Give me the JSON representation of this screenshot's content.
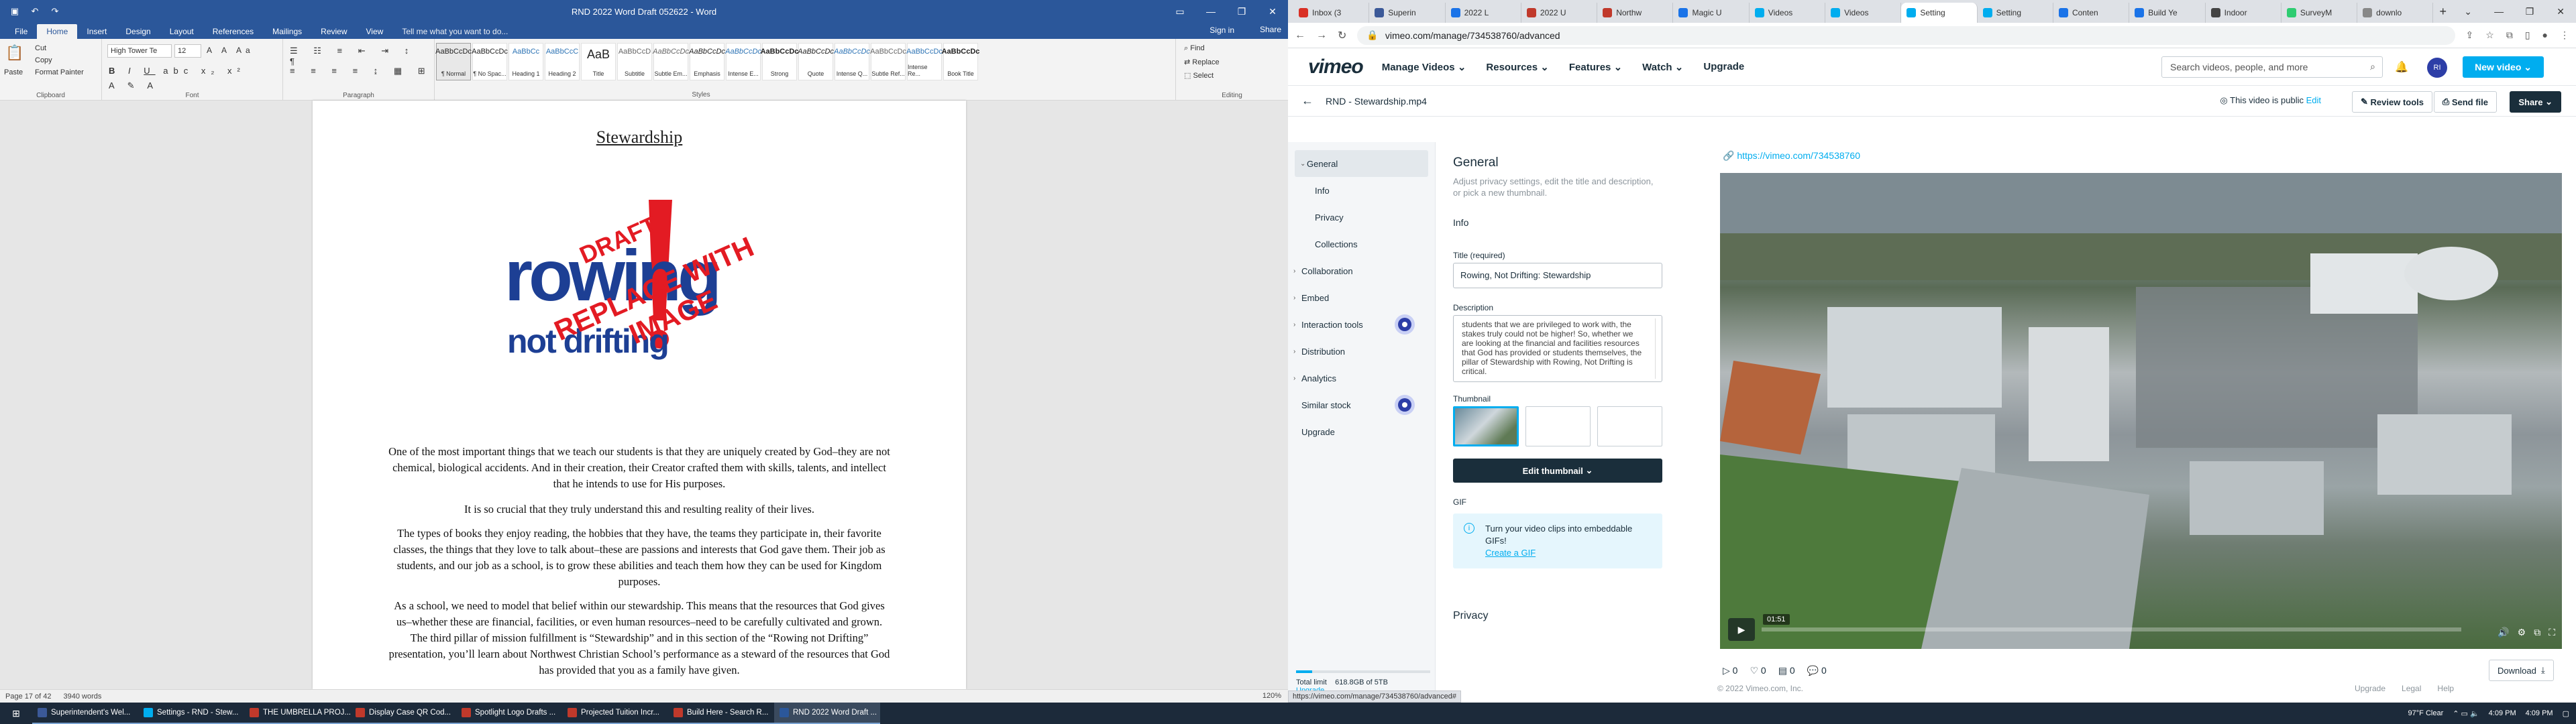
{
  "word": {
    "title": "RND 2022 Word Draft 052622 - Word",
    "sign_in": "Sign in",
    "share": "Share",
    "tabs": [
      "File",
      "Home",
      "Insert",
      "Design",
      "Layout",
      "References",
      "Mailings",
      "Review",
      "View"
    ],
    "tell_me": "Tell me what you want to do...",
    "clipboard": {
      "paste": "Paste",
      "cut": "Cut",
      "copy": "Copy",
      "format_painter": "Format Painter",
      "label": "Clipboard"
    },
    "font": {
      "name": "High Tower Te",
      "size": "12",
      "label": "Font"
    },
    "paragraph_label": "Paragraph",
    "styles": [
      {
        "preview": "AaBbCcDc",
        "name": "¶ Normal"
      },
      {
        "preview": "AaBbCcDc",
        "name": "¶ No Spac..."
      },
      {
        "preview": "AaBbCc",
        "name": "Heading 1"
      },
      {
        "preview": "AaBbCcC",
        "name": "Heading 2"
      },
      {
        "preview": "AaB",
        "name": "Title"
      },
      {
        "preview": "AaBbCcD",
        "name": "Subtitle"
      },
      {
        "preview": "AaBbCcDc",
        "name": "Subtle Em..."
      },
      {
        "preview": "AaBbCcDc",
        "name": "Emphasis"
      },
      {
        "preview": "AaBbCcDc",
        "name": "Intense E..."
      },
      {
        "preview": "AaBbCcDc",
        "name": "Strong"
      },
      {
        "preview": "AaBbCcDc",
        "name": "Quote"
      },
      {
        "preview": "AaBbCcDc",
        "name": "Intense Q..."
      },
      {
        "preview": "AaBbCcDc",
        "name": "Subtle Ref..."
      },
      {
        "preview": "AaBbCcDc",
        "name": "Intense Re..."
      },
      {
        "preview": "AaBbCcDc",
        "name": "Book Title"
      }
    ],
    "styles_label": "Styles",
    "editing": {
      "find": "Find",
      "replace": "Replace",
      "select": "Select",
      "label": "Editing"
    },
    "document": {
      "heading": "Stewardship",
      "logo": {
        "line1": "rowing",
        "line2": "not drifting",
        "stamp1": "DRAFT",
        "stamp2": "REPLACE WITH",
        "stamp3": "IMAGE"
      },
      "paragraphs": [
        "One of the most important things that we teach our students is that they are uniquely created by God–they are not chemical, biological accidents.  And in their creation, their Creator crafted them with skills, talents, and intellect that he intends to use for His purposes.",
        "It is so crucial that they truly understand this and resulting reality of their lives.",
        "The types of books they enjoy reading, the hobbies that they have, the teams they participate in, their favorite classes, the things that they love to talk about–these are passions and interests that God gave them.  Their job as students, and our job as a school, is to grow these abilities and teach them how they can be used for Kingdom purposes.",
        "As a school, we need to model that belief within our stewardship.  This means that the resources that God gives us–whether these are financial, facilities, or even human resources–need to be carefully cultivated and grown.  The third pillar of mission fulfillment is “Stewardship” and in this section of the “Rowing not Drifting” presentation, you’ll learn about Northwest Christian School’s performance as a steward of the resources that God has provided that you as a family have given."
      ]
    },
    "status": {
      "page": "Page 17 of 42",
      "words": "3940 words",
      "zoom": "120%"
    }
  },
  "browser": {
    "tabs": [
      {
        "label": "Inbox (3",
        "color": "#d93025"
      },
      {
        "label": "Superin",
        "color": "#3b5998"
      },
      {
        "label": "2022 L",
        "color": "#1a73e8"
      },
      {
        "label": "2022 U",
        "color": "#c0392b"
      },
      {
        "label": "Northw",
        "color": "#c0392b"
      },
      {
        "label": "Magic U",
        "color": "#1a73e8"
      },
      {
        "label": "Videos",
        "color": "#00adef"
      },
      {
        "label": "Videos",
        "color": "#00adef"
      },
      {
        "label": "Setting",
        "color": "#00adef",
        "active": true
      },
      {
        "label": "Setting",
        "color": "#00adef"
      },
      {
        "label": "Conten",
        "color": "#1a73e8"
      },
      {
        "label": "Build Ye",
        "color": "#1a73e8"
      },
      {
        "label": "Indoor",
        "color": "#444"
      },
      {
        "label": "SurveyM",
        "color": "#2ecc71"
      },
      {
        "label": "downlo",
        "color": "#888"
      }
    ],
    "url": "vimeo.com/manage/734538760/advanced",
    "status_url": "https://vimeo.com/manage/734538760/advanced#"
  },
  "vimeo": {
    "logo": "vimeo",
    "nav": [
      "Manage Videos",
      "Resources",
      "Features",
      "Watch",
      "Upgrade"
    ],
    "search_placeholder": "Search videos, people, and more",
    "avatar": "RI",
    "new_video": "New video",
    "file_name": "RND - Stewardship.mp4",
    "public_text": "This video is public",
    "edit": "Edit",
    "review_tools": "Review tools",
    "send_file": "Send file",
    "share": "Share",
    "sidebar": [
      {
        "label": "General",
        "type": "section",
        "selected": true
      },
      {
        "label": "Info",
        "type": "sub"
      },
      {
        "label": "Privacy",
        "type": "sub"
      },
      {
        "label": "Collections",
        "type": "sub"
      },
      {
        "label": "Collaboration",
        "type": "section"
      },
      {
        "label": "Embed",
        "type": "section"
      },
      {
        "label": "Interaction tools",
        "type": "section",
        "badge": true
      },
      {
        "label": "Distribution",
        "type": "section"
      },
      {
        "label": "Analytics",
        "type": "section"
      },
      {
        "label": "Similar stock",
        "type": "plain",
        "badge": true
      },
      {
        "label": "Upgrade",
        "type": "plain"
      }
    ],
    "total_limit": {
      "label": "Total limit",
      "value": "618.8GB of 5TB",
      "upgrade": "Upgrade",
      "fraction": 0.12
    },
    "panel": {
      "title": "General",
      "subtitle": "Adjust privacy settings, edit the title and description, or pick a new thumbnail.",
      "info_heading": "Info",
      "title_label": "Title (required)",
      "title_value": "Rowing, Not Drifting:  Stewardship",
      "description_label": "Description",
      "description_value": "students that we are privileged to work with, the stakes truly could not be higher!  So, whether we are looking at the financial and facilities resources that God has provided or students themselves, the pillar of Stewardship with Rowing, Not Drifting is critical.",
      "thumbnail_label": "Thumbnail",
      "edit_thumbnail": "Edit thumbnail",
      "gif_label": "GIF",
      "gif_text": "Turn your video clips into embeddable GIFs!",
      "gif_link": "Create a GIF",
      "privacy_label": "Privacy"
    },
    "video_link": "https://vimeo.com/734538760",
    "player_time": "01:51",
    "stats": [
      "0",
      "0",
      "0",
      "0"
    ],
    "download": "Download",
    "footer": "© 2022 Vimeo.com, Inc.",
    "footer_links": [
      "Upgrade",
      "Legal",
      "Help"
    ]
  },
  "taskbar": {
    "items": [
      {
        "label": "Superintendent's Wel...",
        "color": "#3b5998"
      },
      {
        "label": "Settings - RND - Stew...",
        "color": "#00adef"
      },
      {
        "label": "THE UMBRELLA PROJ...",
        "color": "#c0392b"
      },
      {
        "label": "Display Case QR Cod...",
        "color": "#c0392b"
      },
      {
        "label": "Spotlight Logo Drafts ...",
        "color": "#c0392b"
      },
      {
        "label": "Projected Tuition Incr...",
        "color": "#c0392b"
      },
      {
        "label": "Build Here - Search R...",
        "color": "#c0392b"
      },
      {
        "label": "RND 2022 Word Draft ...",
        "color": "#2b579a",
        "active": true
      }
    ],
    "weather": "97°F  Clear",
    "time": "4:09 PM",
    "time2": "4:09 PM"
  }
}
